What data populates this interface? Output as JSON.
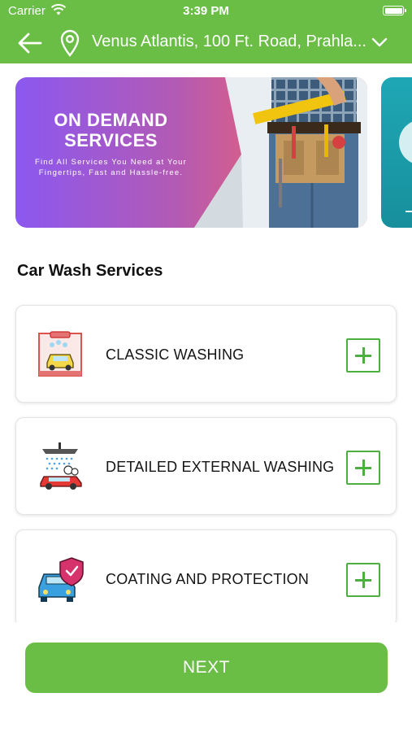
{
  "status_bar": {
    "carrier": "Carrier",
    "time": "3:39 PM"
  },
  "header": {
    "location": "Venus Atlantis, 100 Ft. Road, Prahla..."
  },
  "banner": {
    "title_line1": "ON DEMAND",
    "title_line2": "SERVICES",
    "subtitle": "Find All Services You Need at Your Fingertips, Fast and Hassle-free."
  },
  "section_title": "Car Wash Services",
  "services": [
    {
      "name": "CLASSIC WASHING",
      "icon": "car-wash-tunnel-icon"
    },
    {
      "name": "DETAILED EXTERNAL WASHING",
      "icon": "shower-car-foam-icon"
    },
    {
      "name": "COATING AND PROTECTION",
      "icon": "car-shield-icon"
    }
  ],
  "next_button": "NEXT",
  "colors": {
    "primary_green": "#6abd45",
    "plus_green": "#4caf3f",
    "banner_gradient_start": "#8b58f0",
    "banner_gradient_end": "#f46a6d"
  }
}
